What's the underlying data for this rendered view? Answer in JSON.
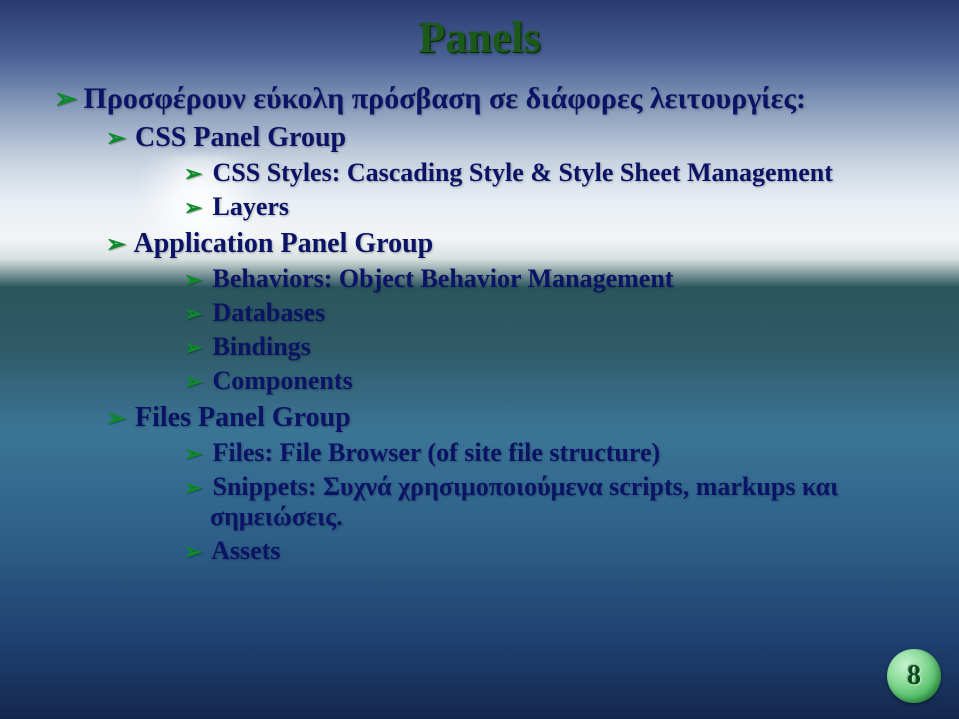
{
  "title": "Panels",
  "page_number": "8",
  "bullets": {
    "lvl1_1": "Προσφέρουν εύκολη πρόσβαση σε διάφορες λειτουργίες:",
    "css_panel_group": "CSS Panel Group",
    "css_styles": "CSS Styles: Cascading Style & Style Sheet Management",
    "layers": "Layers",
    "app_panel_group": "Application Panel Group",
    "behaviors": "Behaviors: Object Behavior Management",
    "databases": "Databases",
    "bindings": "Bindings",
    "components": "Components",
    "files_panel_group": "Files Panel Group",
    "files": "Files: File Browser (of site file structure)",
    "snippets": "Snippets: Συχνά χρησιμοποιούμενα scripts, markups και σημειώσεις.",
    "assets": "Assets"
  }
}
